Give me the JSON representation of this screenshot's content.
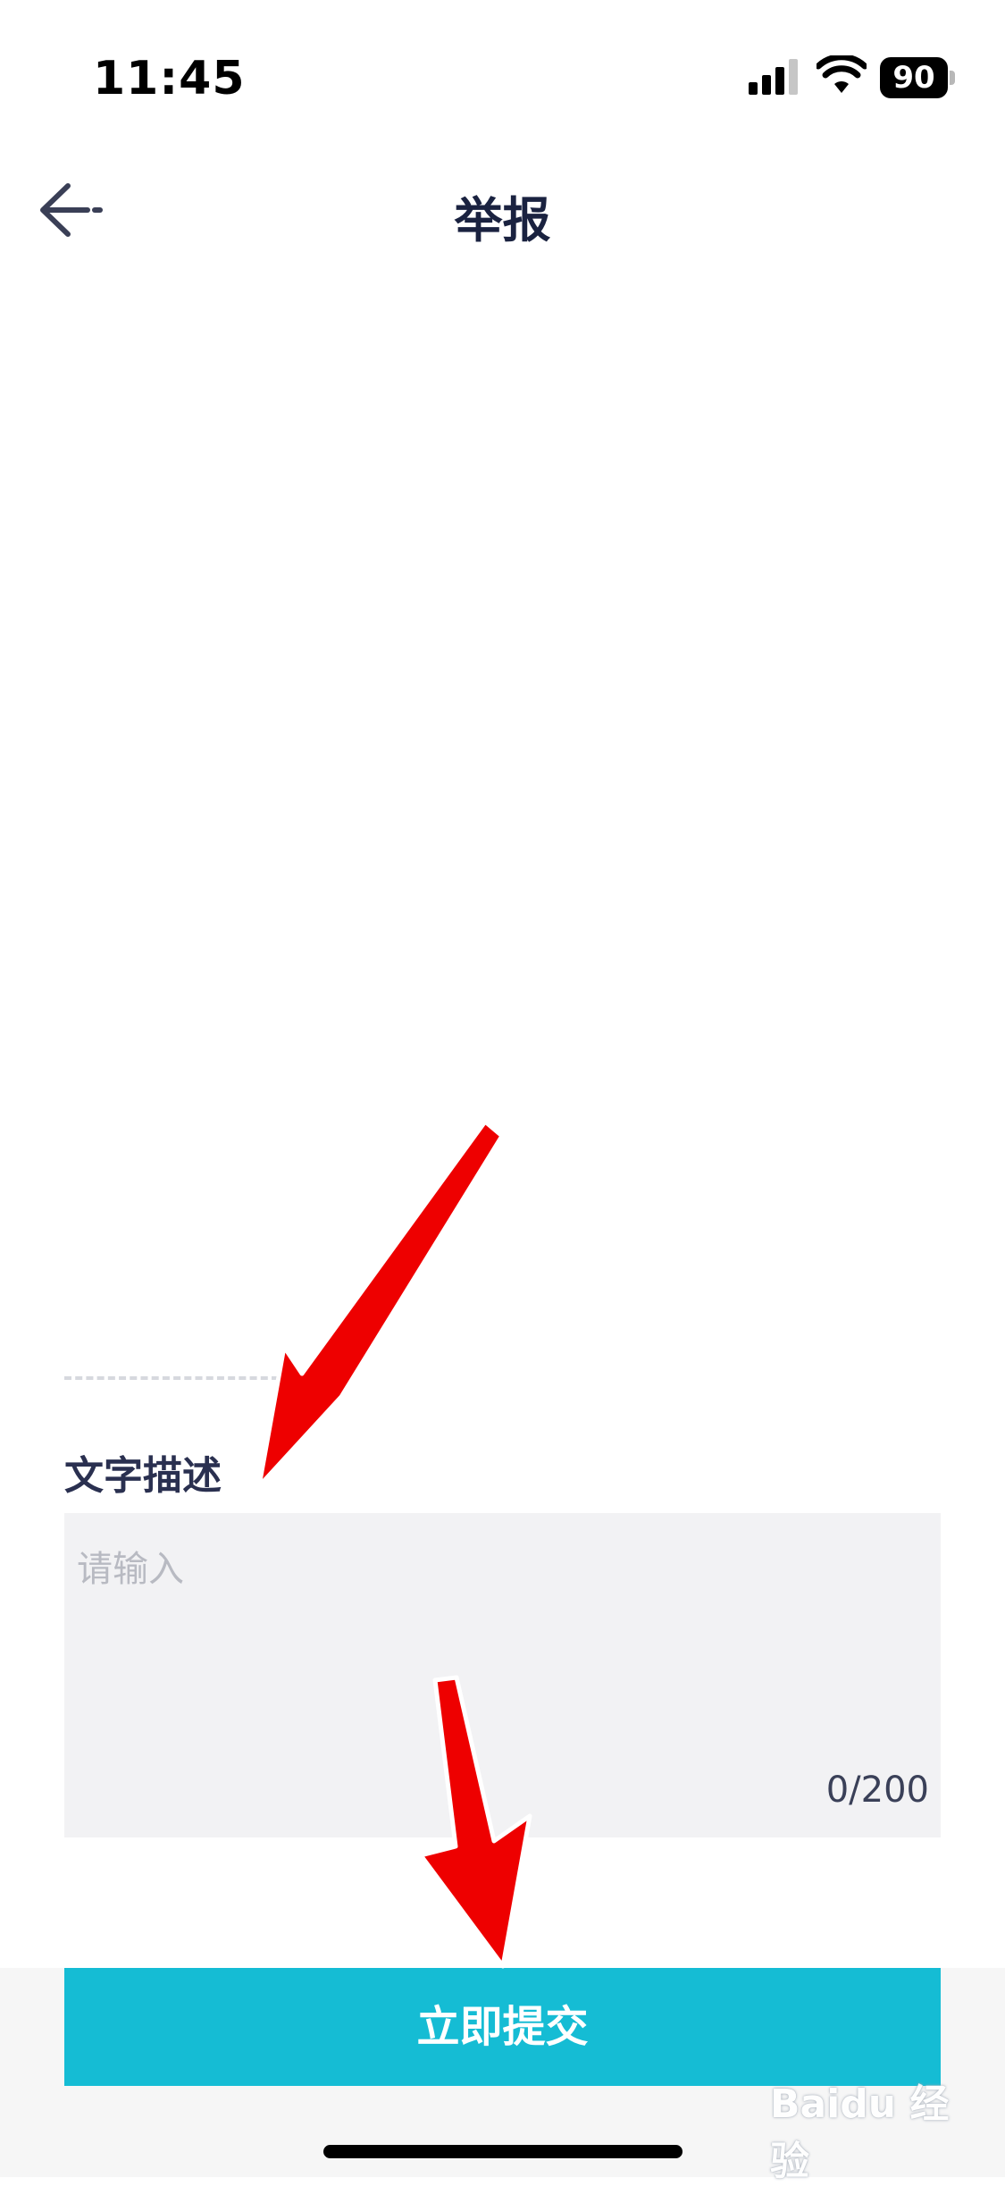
{
  "status_bar": {
    "time": "11:45",
    "battery_level": "90",
    "icons": [
      "signal-icon",
      "wifi-icon",
      "battery-icon"
    ]
  },
  "nav": {
    "back_icon": "back-arrow-icon",
    "title": "举报"
  },
  "description": {
    "label": "文字描述",
    "placeholder": "请输入",
    "value": "",
    "counter": "0/200"
  },
  "submit": {
    "label": "立即提交"
  },
  "watermark": {
    "text": "Baidu 经验"
  },
  "colors": {
    "accent": "#15bcd4",
    "annotation_arrow": "#ee0000",
    "title_text": "#1a2240",
    "input_bg": "#f2f2f4"
  }
}
